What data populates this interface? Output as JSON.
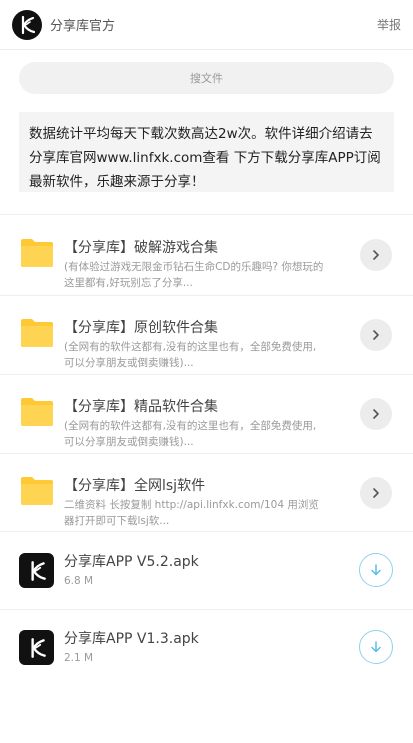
{
  "header": {
    "title": "分享库官方",
    "report_label": "举报"
  },
  "search": {
    "label": "搜文件"
  },
  "notice": {
    "text": "数据统计平均每天下载次数高达2w次。软件详细介绍请去分享库官网www.linfxk.com查看 下方下载分享库APP订阅最新软件，乐趣来源于分享！"
  },
  "folders": [
    {
      "title": "【分享库】破解游戏合集",
      "desc": "(有体验过游戏无限金币钻石生命CD的乐趣吗? 你想玩的这里都有,好玩别忘了分享..."
    },
    {
      "title": "【分享库】原创软件合集",
      "desc": "(全网有的软件这都有,没有的这里也有，全部免费使用,可以分享朋友或倒卖赚钱)..."
    },
    {
      "title": "【分享库】精品软件合集",
      "desc": "(全网有的软件这都有,没有的这里也有，全部免费使用,可以分享朋友或倒卖赚钱)..."
    },
    {
      "title": "【分享库】全网lsj软件",
      "desc": "二维资料 长按复制 http://api.linfxk.com/104 用浏览器打开即可下载lsj软..."
    }
  ],
  "files": [
    {
      "name": "分享库APP V5.2.apk",
      "size": "6.8 M"
    },
    {
      "name": "分享库APP V1.3.apk",
      "size": "2.1 M"
    }
  ],
  "colors": {
    "folder": "#ffc935",
    "download_accent": "#5bbcea",
    "app_icon_bg": "#111111"
  },
  "icons": {
    "logo": "k-logo-icon",
    "folder": "folder-icon",
    "chevron": "chevron-right-icon",
    "download": "download-icon"
  }
}
